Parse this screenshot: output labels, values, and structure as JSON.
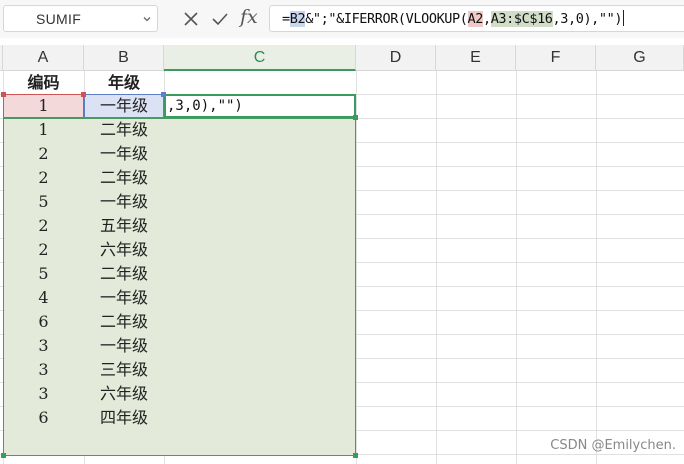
{
  "namebox": {
    "value": "SUMIF"
  },
  "formula_bar": {
    "fx_label": "fx",
    "parts": [
      {
        "text": "=",
        "hl": ""
      },
      {
        "text": "B2",
        "hl": "blue"
      },
      {
        "text": "&\";\"&IFERROR(VLOOKUP(",
        "hl": ""
      },
      {
        "text": "A2",
        "hl": "red"
      },
      {
        "text": ",",
        "hl": ""
      },
      {
        "text": "A3:$C$16",
        "hl": "green"
      },
      {
        "text": ",3,0),\"\")",
        "hl": ""
      }
    ]
  },
  "columns": [
    "A",
    "B",
    "C",
    "D",
    "E",
    "F",
    "G"
  ],
  "header_row": {
    "a": "编码",
    "b": "年级"
  },
  "rows": [
    {
      "a": "1",
      "b": "一年级"
    },
    {
      "a": "1",
      "b": "二年级"
    },
    {
      "a": "2",
      "b": "一年级"
    },
    {
      "a": "2",
      "b": "二年级"
    },
    {
      "a": "5",
      "b": "一年级"
    },
    {
      "a": "2",
      "b": "五年级"
    },
    {
      "a": "2",
      "b": "六年级"
    },
    {
      "a": "5",
      "b": "二年级"
    },
    {
      "a": "4",
      "b": "一年级"
    },
    {
      "a": "6",
      "b": "二年级"
    },
    {
      "a": "3",
      "b": "一年级"
    },
    {
      "a": "3",
      "b": "三年级"
    },
    {
      "a": "3",
      "b": "六年级"
    },
    {
      "a": "6",
      "b": "四年级"
    }
  ],
  "editing_cell_text": ",3,0),\"\")",
  "watermark": "CSDN @Emilychen.",
  "colors": {
    "selection_fill": "#e3ead9",
    "selection_border": "#4a9a63",
    "ref_blue": "#c9d6ee",
    "ref_red": "#f2c9c9"
  }
}
